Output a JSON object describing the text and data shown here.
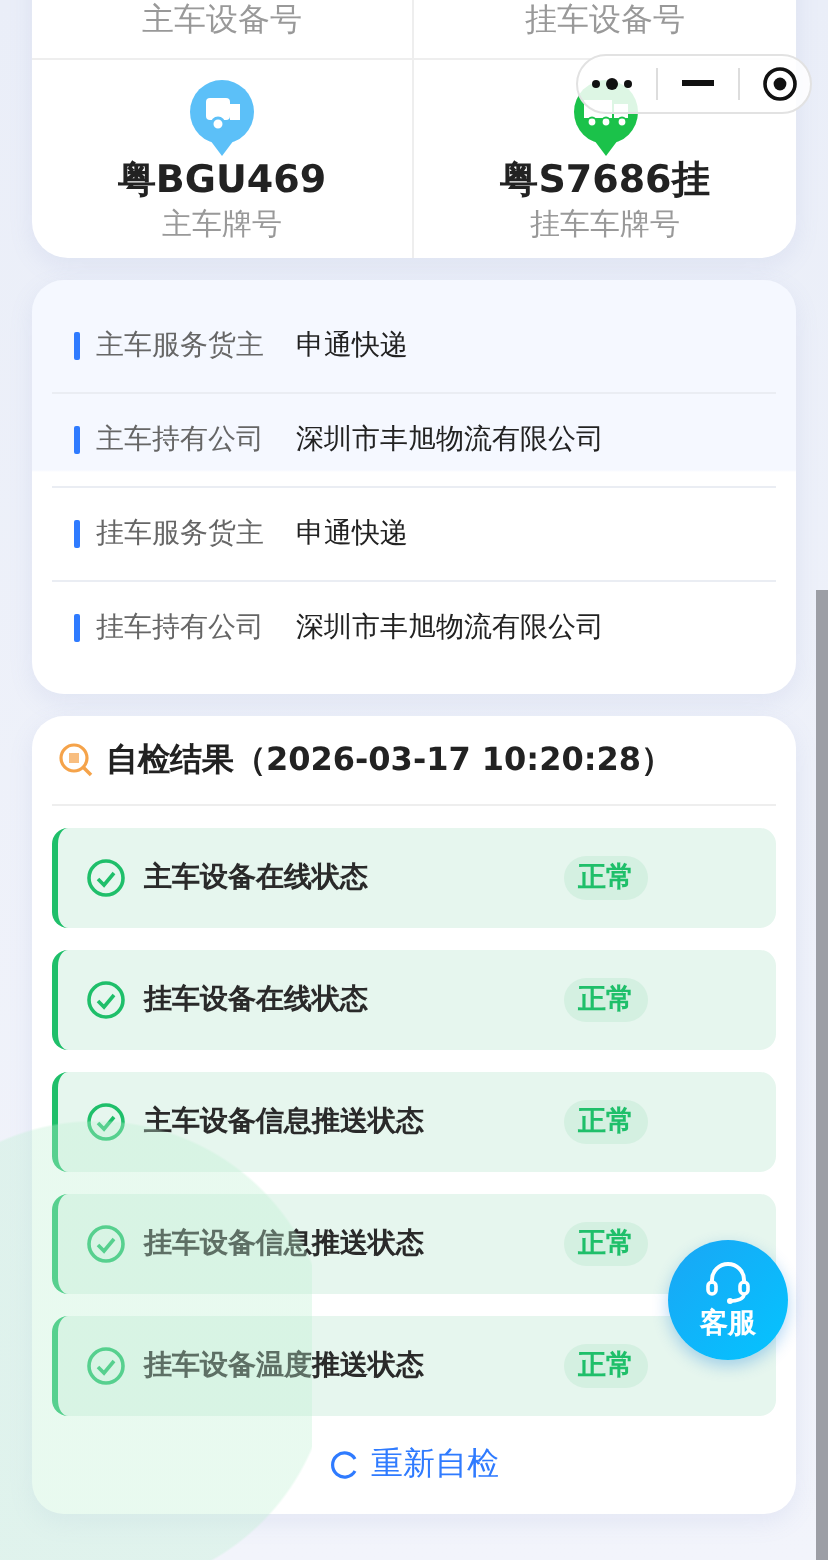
{
  "vehicle_card": {
    "device_labels": [
      "主车设备号",
      "挂车设备号"
    ],
    "plates": [
      {
        "plate": "粤BGU469",
        "label": "主车牌号",
        "kind": "main"
      },
      {
        "plate": "粤S7686挂",
        "label": "挂车车牌号",
        "kind": "trailer"
      }
    ]
  },
  "owner_info": [
    {
      "label": "主车服务货主",
      "value": "申通快递"
    },
    {
      "label": "主车持有公司",
      "value": "深圳市丰旭物流有限公司"
    },
    {
      "label": "挂车服务货主",
      "value": "申通快递"
    },
    {
      "label": "挂车持有公司",
      "value": "深圳市丰旭物流有限公司"
    }
  ],
  "self_check": {
    "title": "自检结果（2026-03-17 10:20:28）",
    "items": [
      {
        "name": "主车设备在线状态",
        "status": "正常",
        "ok": true
      },
      {
        "name": "挂车设备在线状态",
        "status": "正常",
        "ok": true
      },
      {
        "name": "主车设备信息推送状态",
        "status": "正常",
        "ok": true
      },
      {
        "name": "挂车设备信息推送状态",
        "status": "正常",
        "ok": true
      },
      {
        "name": "挂车设备温度推送状态",
        "status": "正常",
        "ok": true
      }
    ],
    "recheck_button": "重新自检"
  },
  "service_button": "客服"
}
